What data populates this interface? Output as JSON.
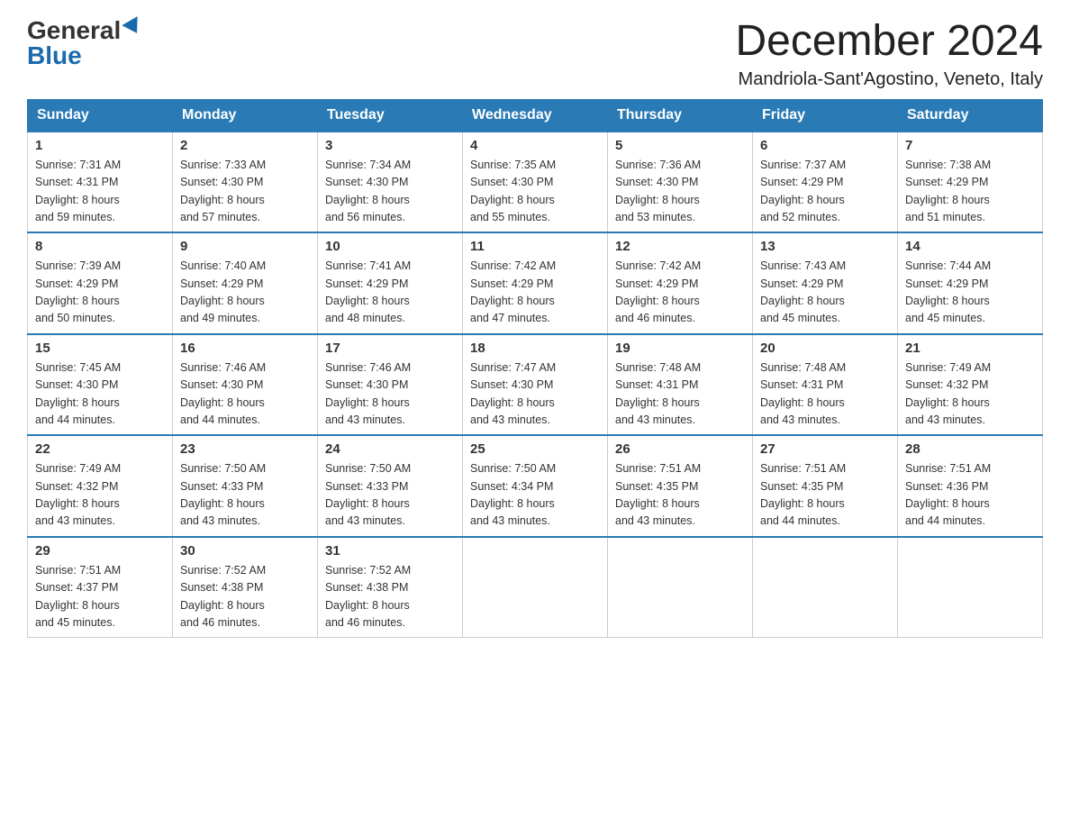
{
  "header": {
    "logo_general": "General",
    "logo_blue": "Blue",
    "main_title": "December 2024",
    "subtitle": "Mandriola-Sant'Agostino, Veneto, Italy"
  },
  "days_of_week": [
    "Sunday",
    "Monday",
    "Tuesday",
    "Wednesday",
    "Thursday",
    "Friday",
    "Saturday"
  ],
  "weeks": [
    [
      {
        "day": "1",
        "sunrise": "7:31 AM",
        "sunset": "4:31 PM",
        "daylight": "8 hours and 59 minutes."
      },
      {
        "day": "2",
        "sunrise": "7:33 AM",
        "sunset": "4:30 PM",
        "daylight": "8 hours and 57 minutes."
      },
      {
        "day": "3",
        "sunrise": "7:34 AM",
        "sunset": "4:30 PM",
        "daylight": "8 hours and 56 minutes."
      },
      {
        "day": "4",
        "sunrise": "7:35 AM",
        "sunset": "4:30 PM",
        "daylight": "8 hours and 55 minutes."
      },
      {
        "day": "5",
        "sunrise": "7:36 AM",
        "sunset": "4:30 PM",
        "daylight": "8 hours and 53 minutes."
      },
      {
        "day": "6",
        "sunrise": "7:37 AM",
        "sunset": "4:29 PM",
        "daylight": "8 hours and 52 minutes."
      },
      {
        "day": "7",
        "sunrise": "7:38 AM",
        "sunset": "4:29 PM",
        "daylight": "8 hours and 51 minutes."
      }
    ],
    [
      {
        "day": "8",
        "sunrise": "7:39 AM",
        "sunset": "4:29 PM",
        "daylight": "8 hours and 50 minutes."
      },
      {
        "day": "9",
        "sunrise": "7:40 AM",
        "sunset": "4:29 PM",
        "daylight": "8 hours and 49 minutes."
      },
      {
        "day": "10",
        "sunrise": "7:41 AM",
        "sunset": "4:29 PM",
        "daylight": "8 hours and 48 minutes."
      },
      {
        "day": "11",
        "sunrise": "7:42 AM",
        "sunset": "4:29 PM",
        "daylight": "8 hours and 47 minutes."
      },
      {
        "day": "12",
        "sunrise": "7:42 AM",
        "sunset": "4:29 PM",
        "daylight": "8 hours and 46 minutes."
      },
      {
        "day": "13",
        "sunrise": "7:43 AM",
        "sunset": "4:29 PM",
        "daylight": "8 hours and 45 minutes."
      },
      {
        "day": "14",
        "sunrise": "7:44 AM",
        "sunset": "4:29 PM",
        "daylight": "8 hours and 45 minutes."
      }
    ],
    [
      {
        "day": "15",
        "sunrise": "7:45 AM",
        "sunset": "4:30 PM",
        "daylight": "8 hours and 44 minutes."
      },
      {
        "day": "16",
        "sunrise": "7:46 AM",
        "sunset": "4:30 PM",
        "daylight": "8 hours and 44 minutes."
      },
      {
        "day": "17",
        "sunrise": "7:46 AM",
        "sunset": "4:30 PM",
        "daylight": "8 hours and 43 minutes."
      },
      {
        "day": "18",
        "sunrise": "7:47 AM",
        "sunset": "4:30 PM",
        "daylight": "8 hours and 43 minutes."
      },
      {
        "day": "19",
        "sunrise": "7:48 AM",
        "sunset": "4:31 PM",
        "daylight": "8 hours and 43 minutes."
      },
      {
        "day": "20",
        "sunrise": "7:48 AM",
        "sunset": "4:31 PM",
        "daylight": "8 hours and 43 minutes."
      },
      {
        "day": "21",
        "sunrise": "7:49 AM",
        "sunset": "4:32 PM",
        "daylight": "8 hours and 43 minutes."
      }
    ],
    [
      {
        "day": "22",
        "sunrise": "7:49 AM",
        "sunset": "4:32 PM",
        "daylight": "8 hours and 43 minutes."
      },
      {
        "day": "23",
        "sunrise": "7:50 AM",
        "sunset": "4:33 PM",
        "daylight": "8 hours and 43 minutes."
      },
      {
        "day": "24",
        "sunrise": "7:50 AM",
        "sunset": "4:33 PM",
        "daylight": "8 hours and 43 minutes."
      },
      {
        "day": "25",
        "sunrise": "7:50 AM",
        "sunset": "4:34 PM",
        "daylight": "8 hours and 43 minutes."
      },
      {
        "day": "26",
        "sunrise": "7:51 AM",
        "sunset": "4:35 PM",
        "daylight": "8 hours and 43 minutes."
      },
      {
        "day": "27",
        "sunrise": "7:51 AM",
        "sunset": "4:35 PM",
        "daylight": "8 hours and 44 minutes."
      },
      {
        "day": "28",
        "sunrise": "7:51 AM",
        "sunset": "4:36 PM",
        "daylight": "8 hours and 44 minutes."
      }
    ],
    [
      {
        "day": "29",
        "sunrise": "7:51 AM",
        "sunset": "4:37 PM",
        "daylight": "8 hours and 45 minutes."
      },
      {
        "day": "30",
        "sunrise": "7:52 AM",
        "sunset": "4:38 PM",
        "daylight": "8 hours and 46 minutes."
      },
      {
        "day": "31",
        "sunrise": "7:52 AM",
        "sunset": "4:38 PM",
        "daylight": "8 hours and 46 minutes."
      },
      null,
      null,
      null,
      null
    ]
  ],
  "labels": {
    "sunrise": "Sunrise:",
    "sunset": "Sunset:",
    "daylight": "Daylight:"
  }
}
